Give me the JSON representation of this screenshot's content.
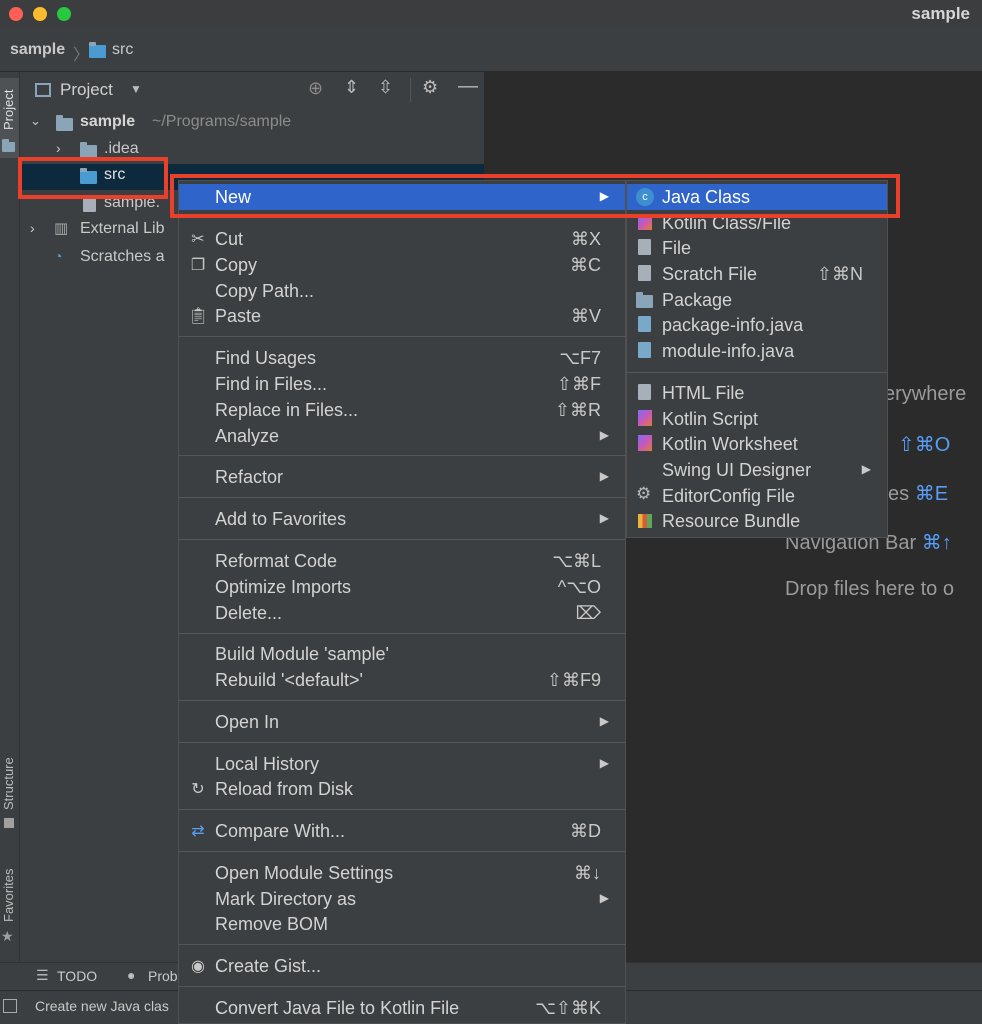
{
  "window": {
    "title": "sample"
  },
  "breadcrumb": {
    "root": "sample",
    "sep": "〉",
    "folder": "src"
  },
  "left_strip": {
    "project": "Project",
    "structure": "Structure",
    "favorites": "Favorites"
  },
  "project_panel": {
    "title": "Project",
    "tree": [
      {
        "name": "sample",
        "path": "~/Programs/sample"
      },
      {
        "name": ".idea"
      },
      {
        "name": "src"
      },
      {
        "name": "sample."
      },
      {
        "name": "External Lib"
      },
      {
        "name": "Scratches a"
      }
    ]
  },
  "editor_hints": {
    "search_everywhere": "erywhere",
    "goto_file_key": "⇧⌘O",
    "recent_files": "es",
    "recent_files_key": "⌘E",
    "navigation_bar": "Navigation Bar",
    "navigation_bar_key": "⌘↑",
    "drop_files": "Drop files here to o"
  },
  "context_menu": {
    "new": "New",
    "cut": {
      "label": "Cut",
      "shortcut": "⌘X"
    },
    "copy": {
      "label": "Copy",
      "shortcut": "⌘C"
    },
    "copy_path": "Copy Path...",
    "paste": {
      "label": "Paste",
      "shortcut": "⌘V"
    },
    "find_usages": {
      "label": "Find Usages",
      "shortcut": "⌥F7"
    },
    "find_in_files": {
      "label": "Find in Files...",
      "shortcut": "⇧⌘F"
    },
    "replace_in_files": {
      "label": "Replace in Files...",
      "shortcut": "⇧⌘R"
    },
    "analyze": "Analyze",
    "refactor": "Refactor",
    "add_to_favorites": "Add to Favorites",
    "reformat_code": {
      "label": "Reformat Code",
      "shortcut": "⌥⌘L"
    },
    "optimize_imports": {
      "label": "Optimize Imports",
      "shortcut": "^⌥O"
    },
    "delete": {
      "label": "Delete...",
      "shortcut": "⌦"
    },
    "build_module": "Build Module 'sample'",
    "rebuild": {
      "label": "Rebuild '<default>'",
      "shortcut": "⇧⌘F9"
    },
    "open_in": "Open In",
    "local_history": "Local History",
    "reload_from_disk": "Reload from Disk",
    "compare_with": {
      "label": "Compare With...",
      "shortcut": "⌘D"
    },
    "open_module_settings": {
      "label": "Open Module Settings",
      "shortcut": "⌘↓"
    },
    "mark_directory_as": "Mark Directory as",
    "remove_bom": "Remove BOM",
    "create_gist": "Create Gist...",
    "convert_java": {
      "label": "Convert Java File to Kotlin File",
      "shortcut": "⌥⇧⌘K"
    }
  },
  "submenu": {
    "java_class": "Java Class",
    "kotlin_class": "Kotlin Class/File",
    "file": "File",
    "scratch_file": {
      "label": "Scratch File",
      "shortcut": "⇧⌘N"
    },
    "package": "Package",
    "package_info": "package-info.java",
    "module_info": "module-info.java",
    "html_file": "HTML File",
    "kotlin_script": "Kotlin Script",
    "kotlin_worksheet": "Kotlin Worksheet",
    "swing_ui_designer": "Swing UI Designer",
    "editorconfig": "EditorConfig File",
    "resource_bundle": "Resource Bundle"
  },
  "bottom_tabs": {
    "todo": "TODO",
    "problems": "Prob"
  },
  "status": {
    "text": "Create new Java clas"
  },
  "colors": {
    "selection": "#2f65ca",
    "highlight_box": "#e8402a",
    "menu_bg": "#3c3f41",
    "editor_bg": "#2b2b2b"
  }
}
